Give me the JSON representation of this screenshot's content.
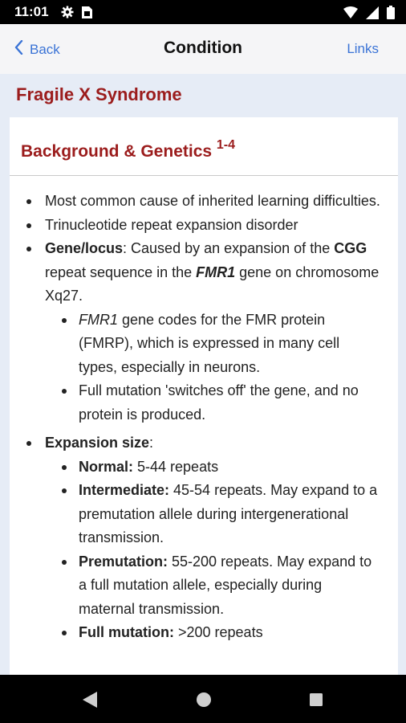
{
  "status": {
    "time": "11:01",
    "icons": [
      "gear-icon",
      "sim-card-icon",
      "wifi-icon",
      "signal-icon",
      "battery-icon"
    ]
  },
  "nav": {
    "back_label": "Back",
    "title": "Condition",
    "links_label": "Links"
  },
  "condition_name": "Fragile X Syndrome",
  "section": {
    "title": "Background & Genetics",
    "refs": "1-4"
  },
  "bullets": {
    "b1": "Most common cause of inherited learning difficulties.",
    "b2": "Trinucleotide repeat expansion disorder",
    "b3": {
      "label": "Gene/locus",
      "t1": ": Caused by an expansion of the ",
      "cgg": "CGG",
      "t2": " repeat sequence in the ",
      "gene": "FMR1",
      "t3": " gene on chromosome Xq27.",
      "sub1_gene": "FMR1",
      "sub1_text": " gene codes for the FMR protein (FMRP), which is expressed in many cell types, especially in neurons.",
      "sub2_text": "Full mutation 'switches off' the gene, and no protein is produced."
    },
    "b4": {
      "label": "Expansion size",
      "colon": ":",
      "items": [
        {
          "label": "Normal:",
          "text": " 5-44 repeats"
        },
        {
          "label": "Intermediate:",
          "text": " 45-54 repeats. May expand to a premutation allele during intergenerational transmission."
        },
        {
          "label": "Premutation:",
          "text": " 55-200 repeats. May expand to a full mutation allele, especially during maternal transmission."
        },
        {
          "label": "Full mutation:",
          "text": " >200 repeats"
        }
      ]
    }
  }
}
